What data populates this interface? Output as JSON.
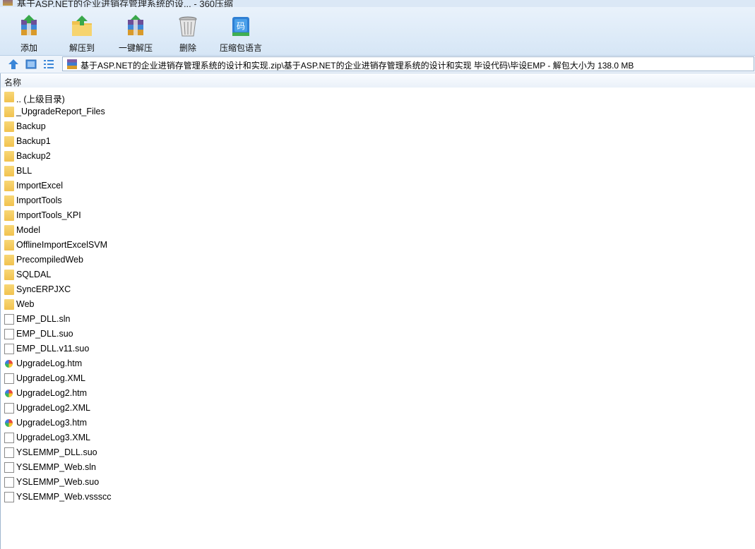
{
  "window": {
    "title": "基于ASP.NET的企业进销存管理系统的设... - 360压缩"
  },
  "toolbar": {
    "buttons": [
      {
        "label": "添加",
        "icon": "add-archive-icon"
      },
      {
        "label": "解压到",
        "icon": "extract-to-icon"
      },
      {
        "label": "一键解压",
        "icon": "one-click-extract-icon"
      },
      {
        "label": "删除",
        "icon": "trash-icon"
      },
      {
        "label": "压缩包语言",
        "icon": "archive-language-icon"
      }
    ]
  },
  "navbar": {
    "path": "基于ASP.NET的企业进销存管理系统的设计和实现.zip\\基于ASP.NET的企业进销存管理系统的设计和实现 毕设代码\\毕设EMP - 解包大小为 138.0 MB"
  },
  "list": {
    "header": "名称",
    "items": [
      {
        "name": ".. (上级目录)",
        "type": "folder"
      },
      {
        "name": "_UpgradeReport_Files",
        "type": "folder"
      },
      {
        "name": "Backup",
        "type": "folder"
      },
      {
        "name": "Backup1",
        "type": "folder"
      },
      {
        "name": "Backup2",
        "type": "folder"
      },
      {
        "name": "BLL",
        "type": "folder"
      },
      {
        "name": "ImportExcel",
        "type": "folder"
      },
      {
        "name": "ImportTools",
        "type": "folder"
      },
      {
        "name": "ImportTools_KPI",
        "type": "folder"
      },
      {
        "name": "Model",
        "type": "folder"
      },
      {
        "name": "OfflineImportExcelSVM",
        "type": "folder"
      },
      {
        "name": "PrecompiledWeb",
        "type": "folder"
      },
      {
        "name": "SQLDAL",
        "type": "folder"
      },
      {
        "name": "SyncERPJXC",
        "type": "folder"
      },
      {
        "name": "Web",
        "type": "folder"
      },
      {
        "name": "EMP_DLL.sln",
        "type": "file"
      },
      {
        "name": "EMP_DLL.suo",
        "type": "file"
      },
      {
        "name": "EMP_DLL.v11.suo",
        "type": "file"
      },
      {
        "name": "UpgradeLog.htm",
        "type": "web"
      },
      {
        "name": "UpgradeLog.XML",
        "type": "file"
      },
      {
        "name": "UpgradeLog2.htm",
        "type": "web"
      },
      {
        "name": "UpgradeLog2.XML",
        "type": "file"
      },
      {
        "name": "UpgradeLog3.htm",
        "type": "web"
      },
      {
        "name": "UpgradeLog3.XML",
        "type": "file"
      },
      {
        "name": "YSLEMMP_DLL.suo",
        "type": "file"
      },
      {
        "name": "YSLEMMP_Web.sln",
        "type": "file"
      },
      {
        "name": "YSLEMMP_Web.suo",
        "type": "file"
      },
      {
        "name": "YSLEMMP_Web.vssscc",
        "type": "file"
      }
    ]
  }
}
